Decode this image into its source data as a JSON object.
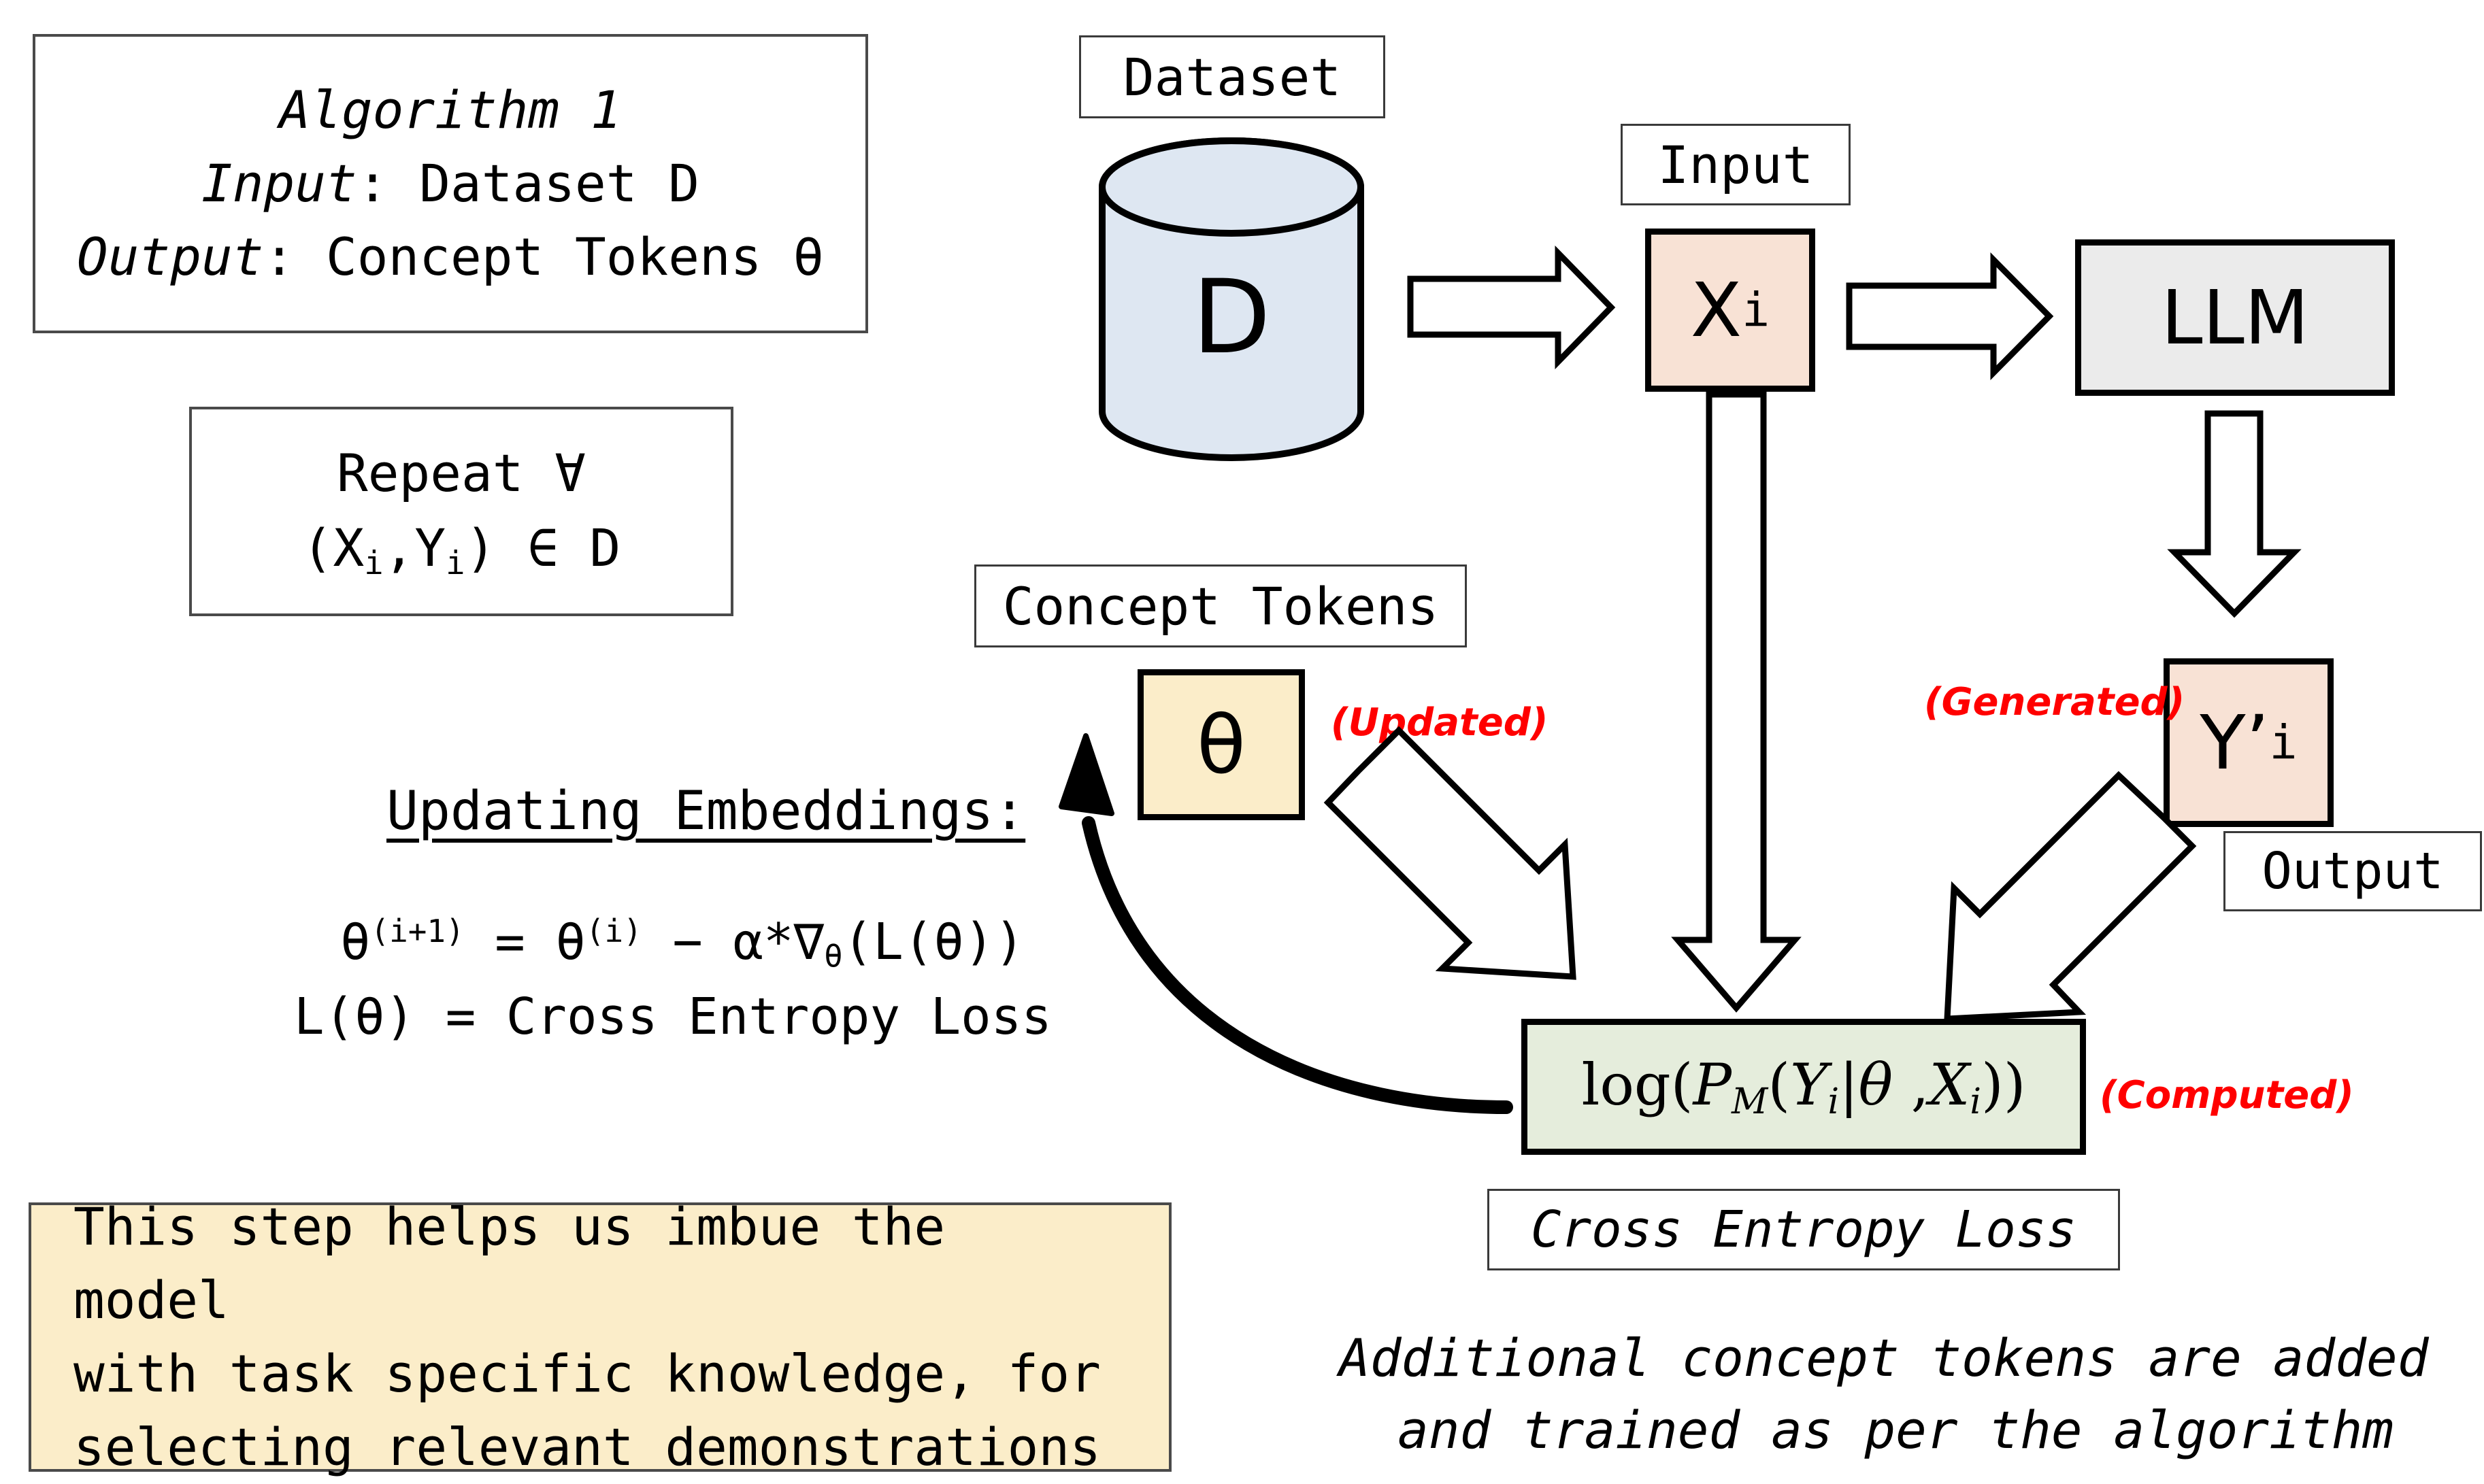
{
  "algorithm_panel": {
    "title": "Algorithm 1",
    "input_label": "Input",
    "input_value": ": Dataset D",
    "output_label": "Output",
    "output_value": ": Concept Tokens θ"
  },
  "repeat_panel": {
    "line1": "Repeat ∀",
    "line2_prefix": "(X",
    "line2_sub1": "i",
    "line2_mid": ",Y",
    "line2_sub2": "i",
    "line2_suffix": ") ∈ D"
  },
  "updating": {
    "heading": "Updating Embeddings:",
    "eq1_a": "θ",
    "eq1_sup1": "(i+1)",
    "eq1_b": " = θ",
    "eq1_sup2": "(i)",
    "eq1_c": " − α*∇",
    "eq1_sub": "θ",
    "eq1_d": "(L(θ))",
    "eq2": "L(θ) = Cross Entropy Loss"
  },
  "note_box": {
    "line1": "This step helps us imbue the model",
    "line2": "with task specific knowledge, for",
    "line3": "selecting relevant demonstrations"
  },
  "caption": {
    "line1": "Additional concept tokens are added",
    "line2": "and trained as per the algorithm"
  },
  "nodes": {
    "dataset_label": "Dataset",
    "dataset_letter": "D",
    "input_label": "Input",
    "x_main": "X",
    "x_sub": "i",
    "llm_label": "LLM",
    "y_main": "Y’",
    "y_sub": "i",
    "generated_tag": "(Generated)",
    "output_label": "Output",
    "concept_tokens_label": "Concept Tokens",
    "theta_symbol": "θ",
    "updated_tag": "(Updated)",
    "loss_expr_a": "log(",
    "loss_expr_P": "P",
    "loss_expr_M": "M",
    "loss_expr_open": "(",
    "loss_expr_Y": "Y",
    "loss_expr_Yi": "i",
    "loss_expr_bar": "|",
    "loss_expr_theta": "θ",
    "loss_expr_comma": " ,",
    "loss_expr_X": "X",
    "loss_expr_Xi": "i",
    "loss_expr_close": "))",
    "computed_tag": "(Computed)",
    "cross_entropy_label": "Cross Entropy Loss"
  },
  "colors": {
    "peach": "#F8E2D5",
    "gray": "#EBEBEB",
    "cream": "#FBEDC9",
    "green": "#E5EDDC",
    "blue": "#DEE7F2",
    "red": "#FF0000",
    "black": "#000000",
    "border_thin": "#4a4a4a"
  },
  "icons": {
    "cylinder": "database-cylinder-icon",
    "arrow_right": "block-arrow-right-icon",
    "arrow_down": "block-arrow-down-icon",
    "arrow_diag_down_right": "block-arrow-diagonal-down-right-icon",
    "arrow_diag_down_left": "block-arrow-diagonal-down-left-icon",
    "curved_feedback": "curved-feedback-arrow-icon"
  }
}
